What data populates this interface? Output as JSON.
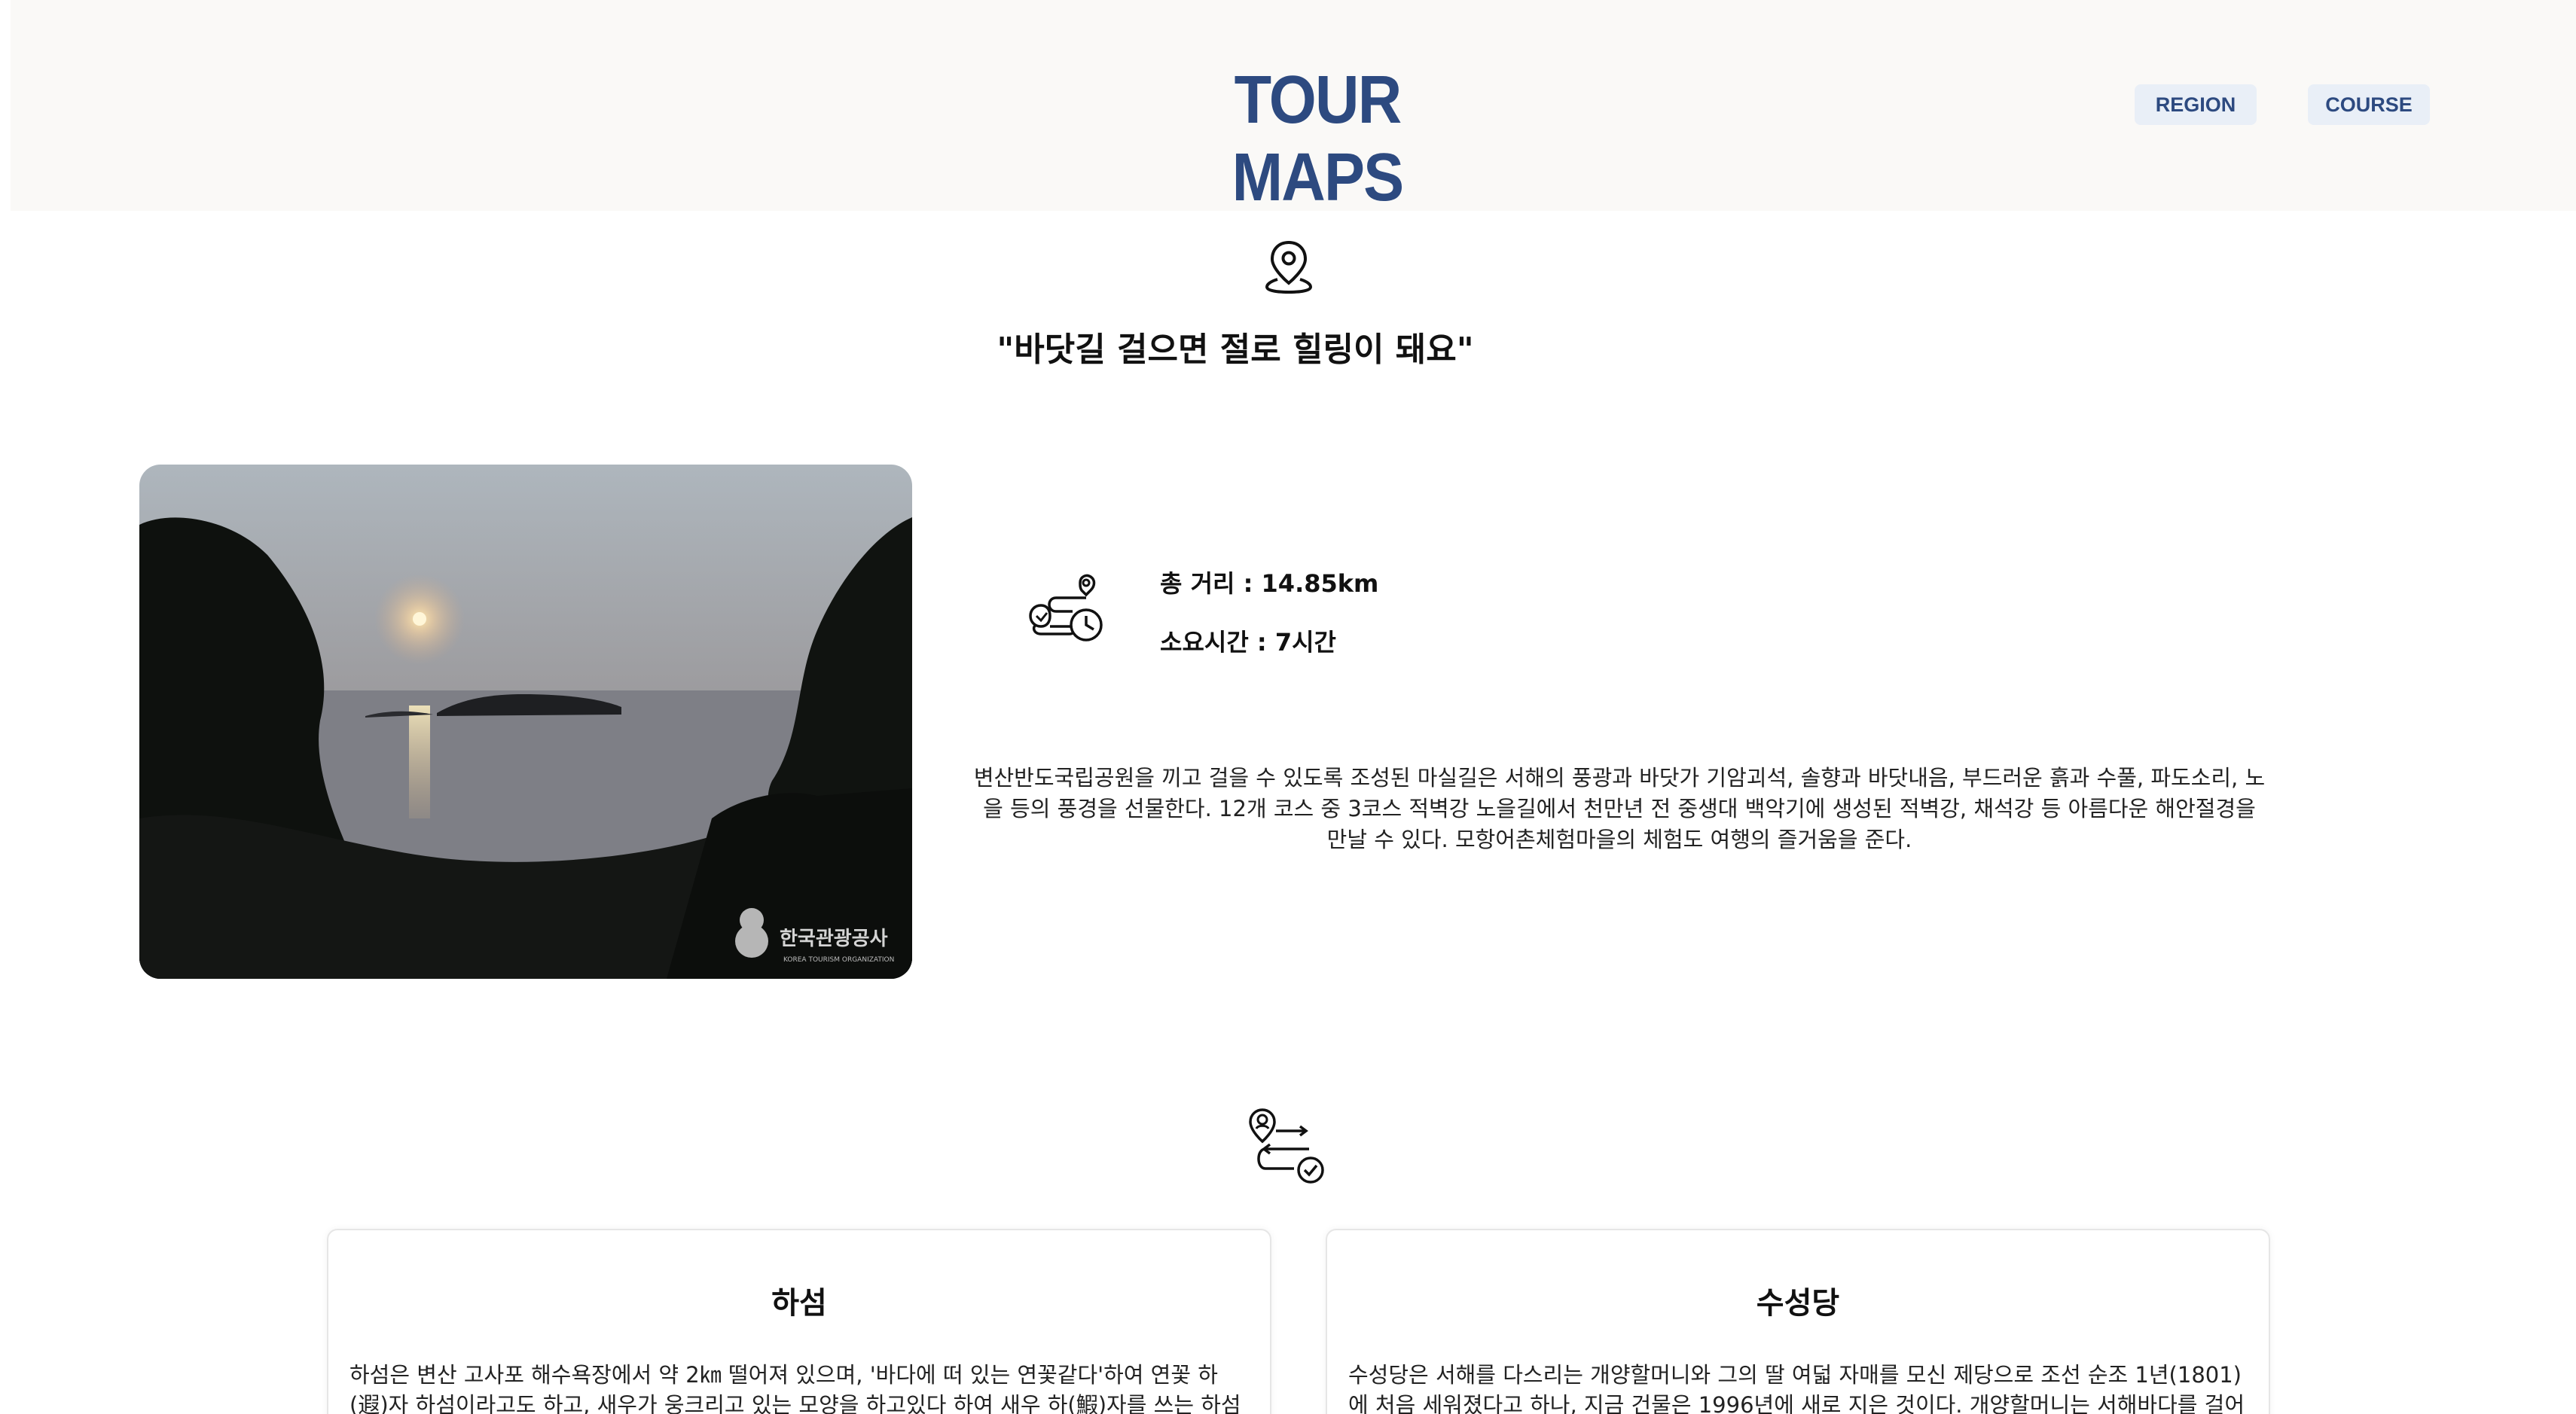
{
  "header": {
    "logo": "TOUR MAPS",
    "nav": [
      {
        "label": "REGION"
      },
      {
        "label": "COURSE"
      }
    ]
  },
  "main": {
    "tagline": "\"바닷길 걸으면 절로 힐링이 돼요\"",
    "photo": {
      "watermark_text": "한국관광공사",
      "watermark_subtext": "KOREA TOURISM ORGANIZATION"
    },
    "stats": {
      "distance": "총 거리 : 14.85km",
      "time": "소요시간 : 7시간"
    },
    "description": "변산반도국립공원을 끼고 걸을 수 있도록 조성된 마실길은 서해의 풍광과 바닷가 기암괴석, 솔향과 바닷내음, 부드러운 흙과 수풀, 파도소리, 노을 등의 풍경을 선물한다. 12개 코스 중 3코스 적벽강 노을길에서 천만년 전 중생대 백악기에 생성된 적벽강, 채석강 등 아름다운 해안절경을 만날 수 있다. 모항어촌체험마을의 체험도 여행의 즐거움을 준다."
  },
  "courses": [
    {
      "title": "하섬",
      "text": "하섬은 변산 고사포 해수욕장에서 약 2㎞ 떨어져 있으며, '바다에 떠 있는 연꽃같다'하여 연꽃 하(遐)자 하섬이라고도 하고, 새우가 웅크리고 있는 모양을 하고있다 하여 새우 하(鰕)자를 쓰는 하섬이라고도 한"
    },
    {
      "title": "수성당",
      "text": "수성당은 서해를 다스리는 개양할머니와 그의 딸 여덟 자매를 모신 제당으로 조선 순조 1년(1801)에 처음 세워졌다고 하나, 지금 건물은 1996년에 새로 지은 것이다. 개양할머니는 서해바다를 걸어다니며 깊은"
    }
  ],
  "icons": {
    "pin": "map-pin-icon",
    "route": "route-clock-icon",
    "course": "course-route-icon"
  },
  "colors": {
    "brand": "#2d4a80",
    "nav_bg": "#e9eff7",
    "header_bg": "#faf9f7"
  }
}
